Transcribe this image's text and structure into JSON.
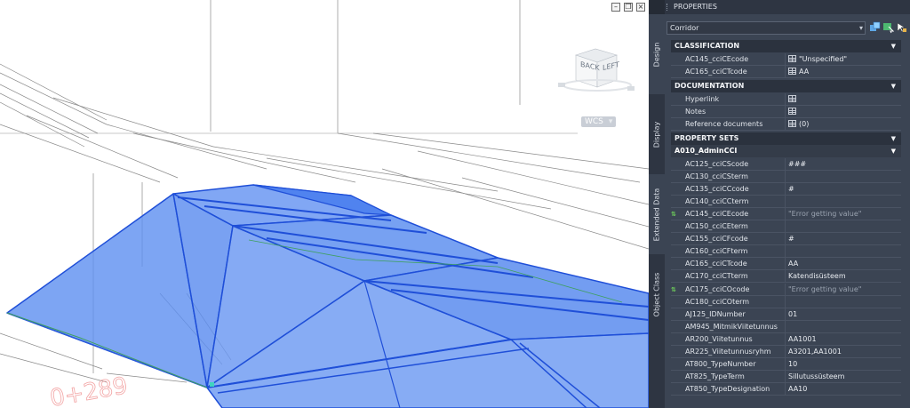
{
  "viewport": {
    "wcs_label": "WCS",
    "viewcube_faces": [
      "BACK",
      "LEFT"
    ],
    "window_controls": [
      "minimize",
      "restore",
      "close"
    ],
    "station_label": "0+289"
  },
  "palette": {
    "title": "PROPERTIES",
    "object_type": "Corridor",
    "side_tabs": [
      "Design",
      "Display",
      "Extended Data",
      "Object Class"
    ],
    "toolbar_icons": [
      "quick-select-icon",
      "select-objects-icon",
      "toggle-pickadd-icon"
    ],
    "classification": {
      "header": "CLASSIFICATION",
      "rows": [
        {
          "name": "AC145_cciCEcode",
          "value": "\"Unspecified\""
        },
        {
          "name": "AC165_cciCTcode",
          "value": "AA"
        }
      ]
    },
    "documentation": {
      "header": "DOCUMENTATION",
      "rows": [
        {
          "name": "Hyperlink",
          "value": ""
        },
        {
          "name": "Notes",
          "value": ""
        },
        {
          "name": "Reference documents",
          "value": "(0)"
        }
      ]
    },
    "property_sets": {
      "header": "PROPERTY SETS",
      "set_name": "A010_AdminCCI",
      "rows": [
        {
          "name": "AC125_cciCScode",
          "value": "###"
        },
        {
          "name": "AC130_cciCSterm",
          "value": ""
        },
        {
          "name": "AC135_cciCCcode",
          "value": "#"
        },
        {
          "name": "AC140_cciCCterm",
          "value": ""
        },
        {
          "name": "AC145_cciCEcode",
          "value": "\"Error getting value\""
        },
        {
          "name": "AC150_cciCEterm",
          "value": ""
        },
        {
          "name": "AC155_cciCFcode",
          "value": "#"
        },
        {
          "name": "AC160_cciCFterm",
          "value": ""
        },
        {
          "name": "AC165_cciCTcode",
          "value": "AA"
        },
        {
          "name": "AC170_cciCTterm",
          "value": "Katendisüsteem"
        },
        {
          "name": "AC175_cciCOcode",
          "value": "\"Error getting value\""
        },
        {
          "name": "AC180_cciCOterm",
          "value": ""
        },
        {
          "name": "AJ125_IDNumber",
          "value": "01"
        },
        {
          "name": "AM945_MitmikViitetunnus",
          "value": ""
        },
        {
          "name": "AR200_Viitetunnus",
          "value": "AA1001"
        },
        {
          "name": "AR225_Viitetunnusryhm",
          "value": "A3201,AA1001"
        },
        {
          "name": "AT800_TypeNumber",
          "value": "10"
        },
        {
          "name": "AT825_TypeTerm",
          "value": "Sillutussüsteem"
        },
        {
          "name": "AT850_TypeDesignation",
          "value": "AA10"
        }
      ]
    },
    "colors": {
      "panel_bg": "#3b4453",
      "header_bg": "#2b323e",
      "text": "#e0e4ea",
      "error_text": "#9aa3b0",
      "selection_fill": "#3d78f0",
      "selection_edge": "#1f4fd8"
    }
  }
}
